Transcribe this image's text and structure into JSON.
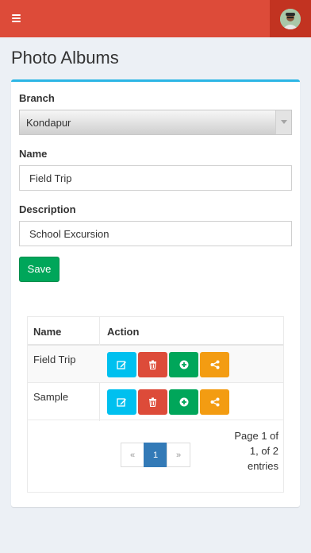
{
  "header": {
    "menu_icon": "hamburger-menu-icon",
    "avatar_icon": "user-avatar",
    "bar_color": "#dd4b39"
  },
  "page": {
    "title": "Photo Albums"
  },
  "form": {
    "branch_label": "Branch",
    "branch_value": "Kondapur",
    "name_label": "Name",
    "name_value": "Field Trip",
    "description_label": "Description",
    "description_value": "School Excursion",
    "save_label": "Save"
  },
  "table": {
    "headers": [
      "Name",
      "Action"
    ],
    "rows": [
      {
        "name": "Field Trip"
      },
      {
        "name": "Sample"
      }
    ],
    "action_icons": [
      "edit-icon",
      "trash-icon",
      "plus-circle-icon",
      "share-icon"
    ],
    "action_colors": {
      "edit": "#00c0ef",
      "delete": "#dd4b39",
      "add": "#00a65a",
      "share": "#f39c12"
    },
    "pagination": {
      "prev": "«",
      "current": "1",
      "next": "»"
    },
    "info": "Page 1 of 1, of 2 entries"
  }
}
